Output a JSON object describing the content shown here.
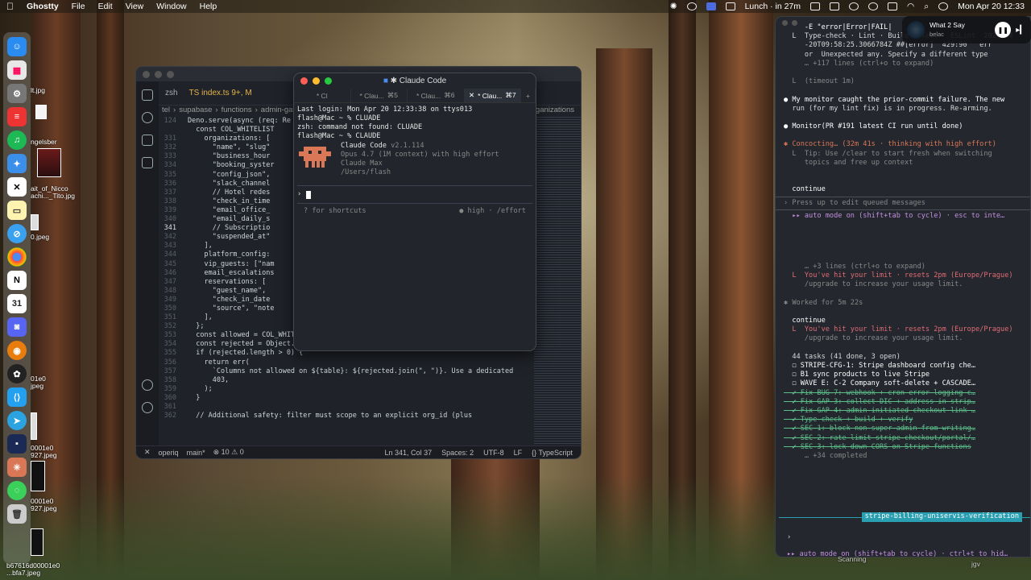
{
  "menubar": {
    "app": "Ghostty",
    "menus": [
      "File",
      "Edit",
      "View",
      "Window",
      "Help"
    ],
    "lunch": "Lunch · in 27m",
    "clock": "Mon Apr 20  12:33"
  },
  "now_playing": {
    "title": "What 2 Say",
    "artist": "belac"
  },
  "desktop_files": [
    "lt.jpg",
    "ngelsber",
    "ait_of_Nicco\nachi..._Tito.jpg",
    "0.jpeg",
    "01e0\njpeg",
    "0001e0\n927.jpeg",
    "0001e0\n927.jpeg",
    "b67616d00001e0\n...bfa7.jpeg"
  ],
  "vscode": {
    "tabs": [
      "zsh",
      "TS index.ts 9+, M"
    ],
    "breadcrumb": [
      "tel",
      "supabase",
      "functions",
      "admin-gate"
    ],
    "code": [
      {
        "n": "124",
        "t": "Deno.serve(async (req: Re"
      },
      {
        "n": "",
        "t": "  const COL_WHITELIST"
      },
      {
        "n": "331",
        "t": "    organizations: ["
      },
      {
        "n": "332",
        "t": "      \"name\", \"slug\""
      },
      {
        "n": "333",
        "t": "      \"business_hour"
      },
      {
        "n": "334",
        "t": "      \"booking_syster"
      },
      {
        "n": "335",
        "t": "      \"config_json\","
      },
      {
        "n": "336",
        "t": "      \"slack_channel"
      },
      {
        "n": "337",
        "t": "      // Hotel redes"
      },
      {
        "n": "338",
        "t": "      \"check_in_time"
      },
      {
        "n": "339",
        "t": "      \"email_office_"
      },
      {
        "n": "340",
        "t": "      \"email_daily_s"
      },
      {
        "n": "341",
        "t": "      // Subscriptio"
      },
      {
        "n": "342",
        "t": "      \"suspended_at\""
      },
      {
        "n": "343",
        "t": "    ],"
      },
      {
        "n": "344",
        "t": "    platform_config:"
      },
      {
        "n": "345",
        "t": "    vip_guests: [\"nam"
      },
      {
        "n": "346",
        "t": "    email_escalations"
      },
      {
        "n": "347",
        "t": "    reservations: ["
      },
      {
        "n": "348",
        "t": "      \"guest_name\","
      },
      {
        "n": "349",
        "t": "      \"check_in_date"
      },
      {
        "n": "350",
        "t": "      \"source\", \"note"
      },
      {
        "n": "351",
        "t": "    ],"
      },
      {
        "n": "352",
        "t": "  };"
      },
      {
        "n": "353",
        "t": "  const allowed = COL_WHITELIST[table] ?? [];"
      },
      {
        "n": "354",
        "t": "  const rejected = Object.keys(updateData).filter((k) => !allowed.includes(k));"
      },
      {
        "n": "355",
        "t": "  if (rejected.length > 0) {"
      },
      {
        "n": "356",
        "t": "    return err("
      },
      {
        "n": "357",
        "t": "      `Columns not allowed on ${table}: ${rejected.join(\", \")}. Use a dedicated"
      },
      {
        "n": "358",
        "t": "      403,"
      },
      {
        "n": "359",
        "t": "    );"
      },
      {
        "n": "360",
        "t": "  }"
      },
      {
        "n": "361",
        "t": ""
      },
      {
        "n": "362",
        "t": "  // Additional safety: filter must scope to an explicit org_id (plus"
      }
    ],
    "status": {
      "branch": "main*",
      "problems": "⊗ 10 ⚠ 0",
      "position": "Ln 341, Col 37",
      "spaces": "Spaces: 2",
      "encoding": "UTF-8",
      "eol": "LF",
      "lang": "{} TypeScript",
      "workspace": "operiq"
    },
    "right_label": "organizations"
  },
  "ghostty": {
    "title": "Claude Code",
    "tabs": [
      {
        "label": "* Cl",
        "key": ""
      },
      {
        "label": "* Clau...",
        "key": "⌘5"
      },
      {
        "label": "* Clau...",
        "key": "⌘6"
      },
      {
        "label": "* Clau...",
        "key": "⌘7"
      }
    ],
    "lines": [
      "Last login: Mon Apr 20 12:33:38 on ttys013",
      "flash@Mac ~ % CLUADE",
      "zsh: command not found: CLUADE",
      "flash@Mac ~ % CLAUDE"
    ],
    "cc_name": "Claude Code",
    "cc_version": "v2.1.114",
    "cc_model": "Opus 4.7 (1M context) with high effort",
    "cc_plan": "Claude Max",
    "cc_path": "/Users/flash",
    "prompt_symbol": "›",
    "hint_left": "? for shortcuts",
    "hint_right": "● high · /effort"
  },
  "right_terminal": {
    "lines": [
      {
        "t": "     -E \"error|Error|FAIL|",
        "c": "bold"
      },
      {
        "t": "  L  Type-check · Lint · Build · Test   ESLint  2026-04",
        "c": ""
      },
      {
        "t": "     -20T09:58:25.3066784Z ##[error]  429:90   err",
        "c": ""
      },
      {
        "t": "     or  Unexpected any. Specify a different type",
        "c": ""
      },
      {
        "t": "     … +117 lines (ctrl+o to expand)",
        "c": "grey"
      },
      {
        "t": "",
        "c": "gap"
      },
      {
        "t": "  L  (timeout 1m)",
        "c": "grey"
      },
      {
        "t": "",
        "c": "gap"
      },
      {
        "t": "● My monitor caught the prior-commit failure. The new",
        "c": "bold"
      },
      {
        "t": "  run (for my lint fix) is in progress. Re-arming.",
        "c": ""
      },
      {
        "t": "",
        "c": "gap"
      },
      {
        "t": "● Monitor(PR #191 latest CI run until done)",
        "c": "bold"
      },
      {
        "t": "",
        "c": "gap"
      },
      {
        "t": "✱ Concocting… (32m 41s · thinking with high effort)",
        "c": "orange"
      },
      {
        "t": "  L  Tip: Use /clear to start fresh when switching",
        "c": "grey"
      },
      {
        "t": "     topics and free up context",
        "c": "grey"
      },
      {
        "t": "",
        "c": "gap"
      },
      {
        "t": "",
        "c": "gap"
      },
      {
        "t": "  continue",
        "c": "bold"
      },
      {
        "t": "",
        "c": "sep"
      },
      {
        "t": "› Press up to edit queued messages",
        "c": "grey"
      },
      {
        "t": "",
        "c": "sep"
      },
      {
        "t": "  ▸▸ auto mode on (shift+tab to cycle) · esc to inte…",
        "c": "purple"
      }
    ],
    "lines2": [
      {
        "t": "     … +3 lines (ctrl+o to expand)",
        "c": "grey"
      },
      {
        "t": "  L  You've hit your limit · resets 2pm (Europe/Prague)",
        "c": "red"
      },
      {
        "t": "     /upgrade to increase your usage limit.",
        "c": "grey"
      },
      {
        "t": "",
        "c": "gap"
      },
      {
        "t": "✱ Worked for 5m 22s",
        "c": "grey"
      },
      {
        "t": "",
        "c": "gap"
      },
      {
        "t": "  continue",
        "c": "bold"
      },
      {
        "t": "  L  You've hit your limit · resets 2pm (Europe/Prague)",
        "c": "red"
      },
      {
        "t": "     /upgrade to increase your usage limit.",
        "c": "grey"
      },
      {
        "t": "",
        "c": "gap"
      },
      {
        "t": "  44 tasks (41 done, 3 open)",
        "c": ""
      },
      {
        "t": "  ☐ STRIPE-CFG-1: Stripe dashboard config che…",
        "c": "bold"
      },
      {
        "t": "  ☐ B1 sync products to live Stripe",
        "c": "bold"
      },
      {
        "t": "  ☐ WAVE E: C-2 Company soft-delete + CASCADE…",
        "c": "bold"
      },
      {
        "t": "  ✔ Fix BUG-7: webhook + cron error logging c…",
        "c": "strike"
      },
      {
        "t": "  ✔ Fix GAP-3: collect DIC + address in strip…",
        "c": "strike"
      },
      {
        "t": "  ✔ Fix GAP-4: admin-initiated checkout link …",
        "c": "strike"
      },
      {
        "t": "  ✔ Type-check + build + verify",
        "c": "strike"
      },
      {
        "t": "  ✔ SEC-1: block non-super-admin from writing…",
        "c": "strike"
      },
      {
        "t": "  ✔ SEC-2: rate limit stripe-checkout/portal/…",
        "c": "strike"
      },
      {
        "t": "  ✔ SEC-3: lock down CORS on Stripe functions",
        "c": "strike"
      },
      {
        "t": "     … +34 completed",
        "c": "grey"
      }
    ],
    "badge": "stripe-billing-uniservis-verification",
    "prompt": "›",
    "footer": "▸▸ auto mode on (shift+tab to cycle) · ctrl+t to hid…"
  },
  "bottom_labels": {
    "a": "Scanning",
    "b": "jgv"
  }
}
